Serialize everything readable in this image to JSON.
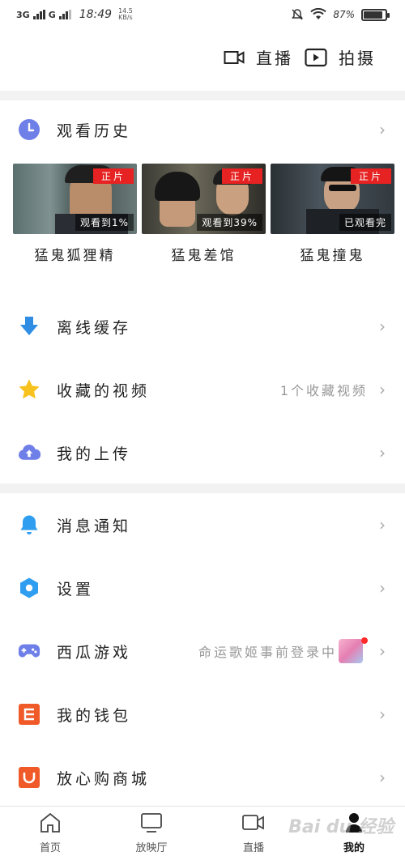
{
  "status": {
    "network": "3G",
    "network2": "G",
    "time": "18:49",
    "speed_value": "14.5",
    "speed_unit": "KB/s",
    "battery": "87%",
    "battery_level": 0.87
  },
  "top_actions": {
    "live": "直播",
    "shoot": "拍摄"
  },
  "history": {
    "title": "观看历史",
    "items": [
      {
        "title": "猛鬼狐狸精",
        "tag": "正片",
        "progress": "观看到1%"
      },
      {
        "title": "猛鬼差馆",
        "tag": "正片",
        "progress": "观看到39%"
      },
      {
        "title": "猛鬼撞鬼",
        "tag": "正片",
        "progress": "已观看完"
      }
    ]
  },
  "menu1": [
    {
      "label": "离线缓存",
      "right": ""
    },
    {
      "label": "收藏的视频",
      "right": "1个收藏视频"
    },
    {
      "label": "我的上传",
      "right": ""
    }
  ],
  "menu2": [
    {
      "label": "消息通知",
      "right": ""
    },
    {
      "label": "设置",
      "right": ""
    },
    {
      "label": "西瓜游戏",
      "right": "命运歌姬事前登录中"
    },
    {
      "label": "我的钱包",
      "right": ""
    },
    {
      "label": "放心购商城",
      "right": ""
    }
  ],
  "tabs": [
    {
      "label": "首页"
    },
    {
      "label": "放映厅"
    },
    {
      "label": "直播"
    },
    {
      "label": "我的"
    }
  ],
  "chevron": "›",
  "watermark": "Bai du 经验",
  "colors": {
    "history_icon": "#6f7fe8",
    "download_icon": "#2f8de4",
    "star_icon": "#f7c21e",
    "upload_icon": "#6f7fe8",
    "bell_icon": "#2f9ef0",
    "settings_icon": "#2f9ef0",
    "game_icon": "#6f7fe8",
    "wallet_icon": "#f05a28",
    "shop_icon": "#f05a28",
    "tag_red": "#e62222"
  }
}
